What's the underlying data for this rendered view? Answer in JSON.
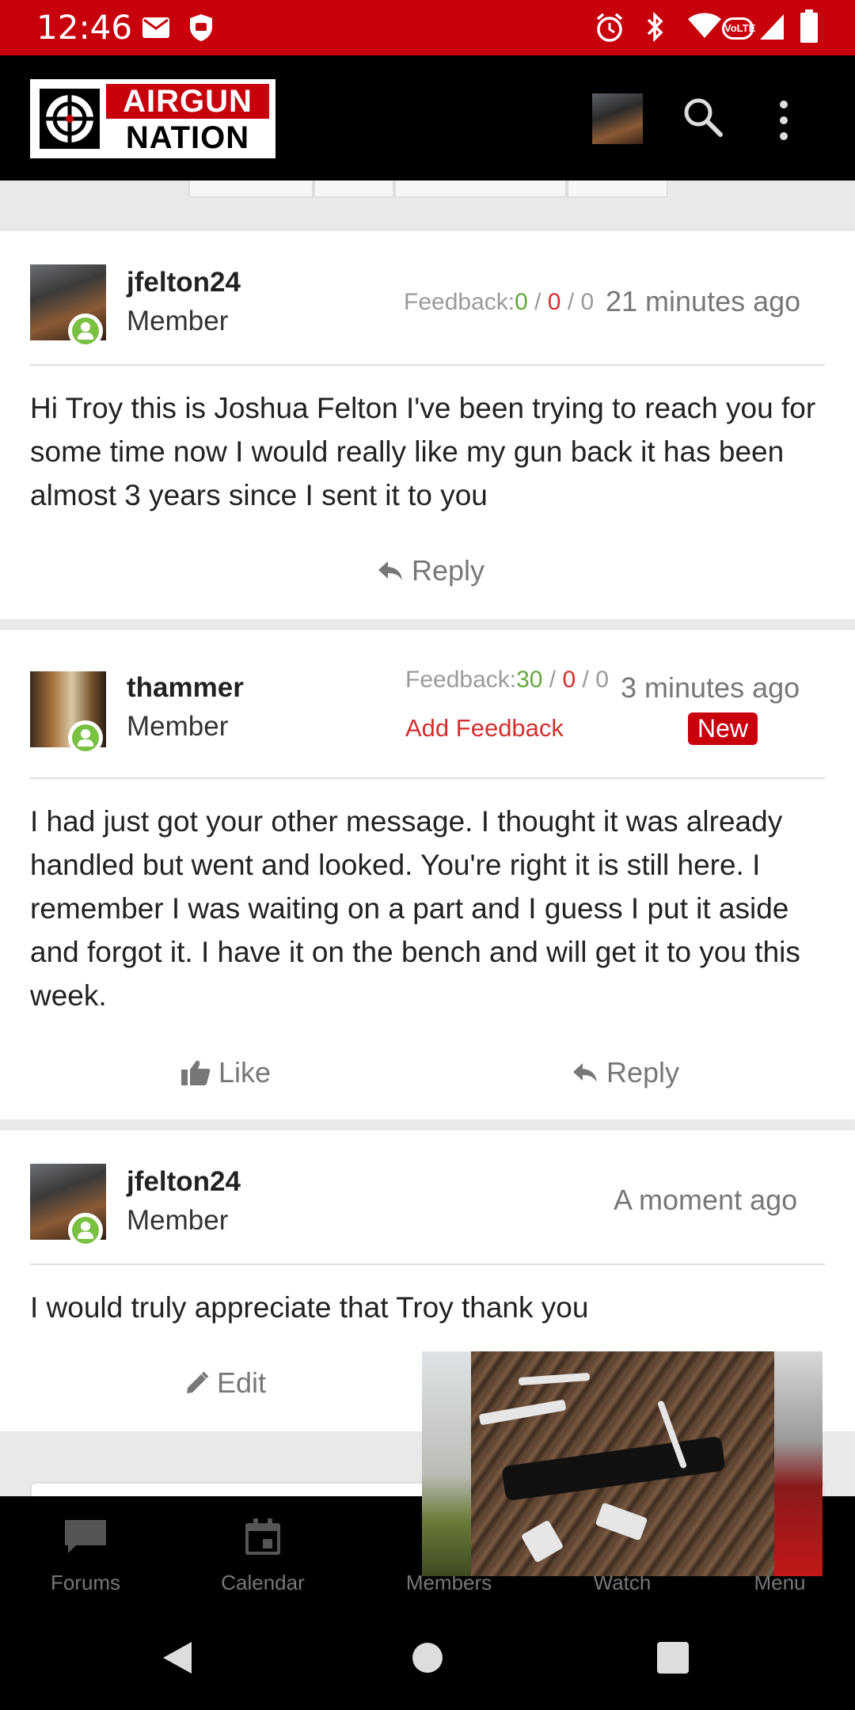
{
  "status_bar": {
    "time": "12:46",
    "icons": [
      "mail-icon",
      "shield-icon",
      "alarm-icon",
      "bluetooth-icon",
      "wifi-icon",
      "volte-icon",
      "signal-icon",
      "battery-icon"
    ],
    "volte_text": "VoLTE"
  },
  "app_bar": {
    "logo_top": "AIRGUN",
    "logo_bottom": "NATION",
    "icons": [
      "search-icon",
      "more-vert-icon"
    ]
  },
  "posts": [
    {
      "username": "jfelton24",
      "role": "Member",
      "feedback_label": "Feedback:",
      "feedback_positive": "0",
      "feedback_negative": "0",
      "feedback_neutral": "0",
      "sep": " / ",
      "time": "21 minutes ago",
      "body": "Hi Troy this is Joshua Felton I've been trying to reach you for some time now I would really like my gun back it has been almost 3 years since I sent it to you",
      "reply_label": "Reply"
    },
    {
      "username": "thammer",
      "role": "Member",
      "feedback_label": "Feedback:",
      "feedback_positive": "30",
      "feedback_negative": "0",
      "feedback_neutral": "0",
      "sep": " / ",
      "time": "3 minutes ago",
      "add_feedback": "Add Feedback",
      "badge": "New",
      "body": "I had just got your other message. I thought it was already handled but went and looked. You're right it is still here. I remember I was waiting on a part and I guess I put it aside and forgot it. I have it on the bench and will get it to you this week.",
      "like_label": "Like",
      "reply_label": "Reply"
    },
    {
      "username": "jfelton24",
      "role": "Member",
      "time": "A moment ago",
      "body": "I would truly appreciate that Troy thank you",
      "edit_label": "Edit"
    }
  ],
  "bottom_nav": {
    "items": [
      {
        "label": "Forums",
        "icon": "forums-icon"
      },
      {
        "label": "Calendar",
        "icon": "calendar-icon"
      },
      {
        "label": "Members",
        "icon": "members-icon"
      },
      {
        "label": "Watch",
        "icon": "watch-icon"
      },
      {
        "label": "Menu",
        "icon": "menu-icon"
      }
    ]
  },
  "system_nav": {
    "icons": [
      "back-icon",
      "home-icon",
      "recents-icon"
    ]
  },
  "colors": {
    "brand_red": "#c8000b",
    "feedback_green": "#63a83a",
    "feedback_red": "#d32f2f",
    "online_green": "#7ac142"
  }
}
